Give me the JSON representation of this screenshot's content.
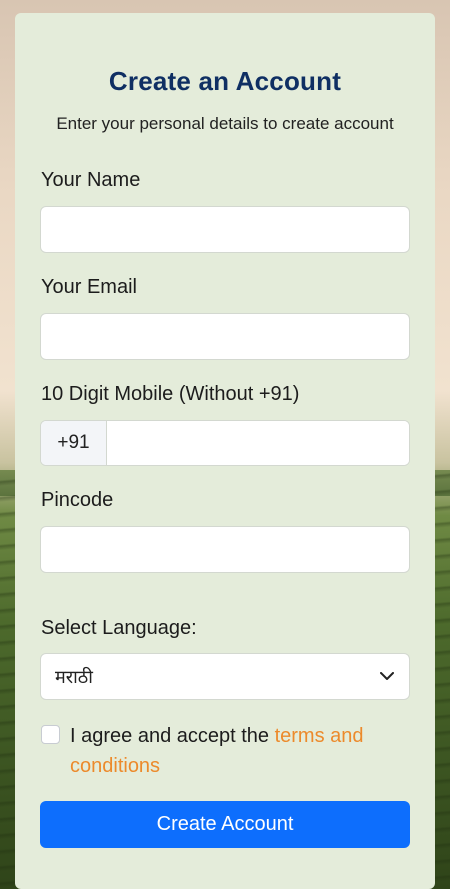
{
  "header": {
    "title": "Create an Account",
    "subtitle": "Enter your personal details to create account"
  },
  "form": {
    "name_label": "Your Name",
    "name_value": "",
    "email_label": "Your Email",
    "email_value": "",
    "mobile_label": "10 Digit Mobile (Without +91)",
    "mobile_prefix": "+91",
    "mobile_value": "",
    "pincode_label": "Pincode",
    "pincode_value": "",
    "language_label": "Select Language:",
    "language_selected": "मराठी",
    "agree_text": "I agree and accept the ",
    "terms_link": "terms and conditions",
    "agree_checked": false,
    "submit_label": "Create Account"
  },
  "colors": {
    "title": "#0f2f63",
    "link": "#ec8a2b",
    "button": "#0d6efd",
    "card": "#e4ecda"
  }
}
